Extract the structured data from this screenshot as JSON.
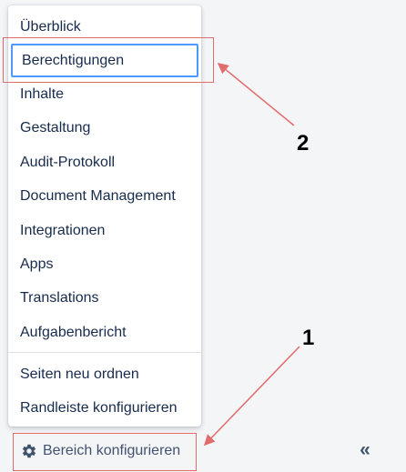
{
  "menu": {
    "items": [
      {
        "label": "Überblick"
      },
      {
        "label": "Berechtigungen"
      },
      {
        "label": "Inhalte"
      },
      {
        "label": "Gestaltung"
      },
      {
        "label": "Audit-Protokoll"
      },
      {
        "label": "Document Management"
      },
      {
        "label": "Integrationen"
      },
      {
        "label": "Apps"
      },
      {
        "label": "Translations"
      },
      {
        "label": "Aufgabenbericht"
      }
    ],
    "secondary_items": [
      {
        "label": "Seiten neu ordnen"
      },
      {
        "label": "Randleiste konfigurieren"
      }
    ]
  },
  "footer": {
    "configure_label": "Bereich konfigurieren",
    "configure_icon": "gear-icon",
    "collapse_label": "«",
    "collapse_icon": "double-chevron-left-icon"
  },
  "annotations": {
    "callout_1": "1",
    "callout_2": "2",
    "color": "#e06c6c"
  },
  "colors": {
    "focus_ring": "#4c9aff",
    "text": "#172b4d",
    "background": "#f4f5f7"
  }
}
